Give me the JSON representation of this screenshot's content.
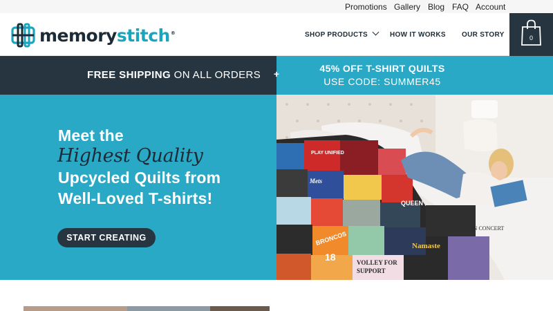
{
  "utility_nav": [
    "Promotions",
    "Gallery",
    "Blog",
    "FAQ",
    "Account"
  ],
  "logo": {
    "text_main": "memory",
    "text_accent": "stitch",
    "reg": "®"
  },
  "nav": {
    "shop_products": "SHOP PRODUCTS",
    "how_it_works": "HOW IT WORKS",
    "our_story": "OUR STORY"
  },
  "cart": {
    "count": "0",
    "icon": "shopping-bag-icon"
  },
  "promo": {
    "left_bold": "FREE SHIPPING",
    "left_rest": "ON ALL ORDERS",
    "plus": "+",
    "right_line1": "45% OFF T-SHIRT QUILTS",
    "right_line2": "USE CODE: SUMMER45"
  },
  "hero": {
    "line1": "Meet the",
    "script": "Highest Quality",
    "line3": "Upcycled Quilts from",
    "line4": "Well-Loved T-shirts!",
    "cta": "START CREATING"
  },
  "quilt_prints": {
    "play_unified": "PLAY UNIFIED",
    "mets": "Mets",
    "volley": "VOLLEY FOR",
    "support": "SUPPORT",
    "namaste": "Namaste",
    "concert": "IN CONCERT",
    "broncos": "BRONCOS",
    "queen": "QUEEN",
    "num18": "18"
  },
  "colors": {
    "navy": "#263540",
    "teal": "#29a9c6",
    "brand_teal": "#1aa5bf",
    "text_dark": "#1d2b36"
  }
}
